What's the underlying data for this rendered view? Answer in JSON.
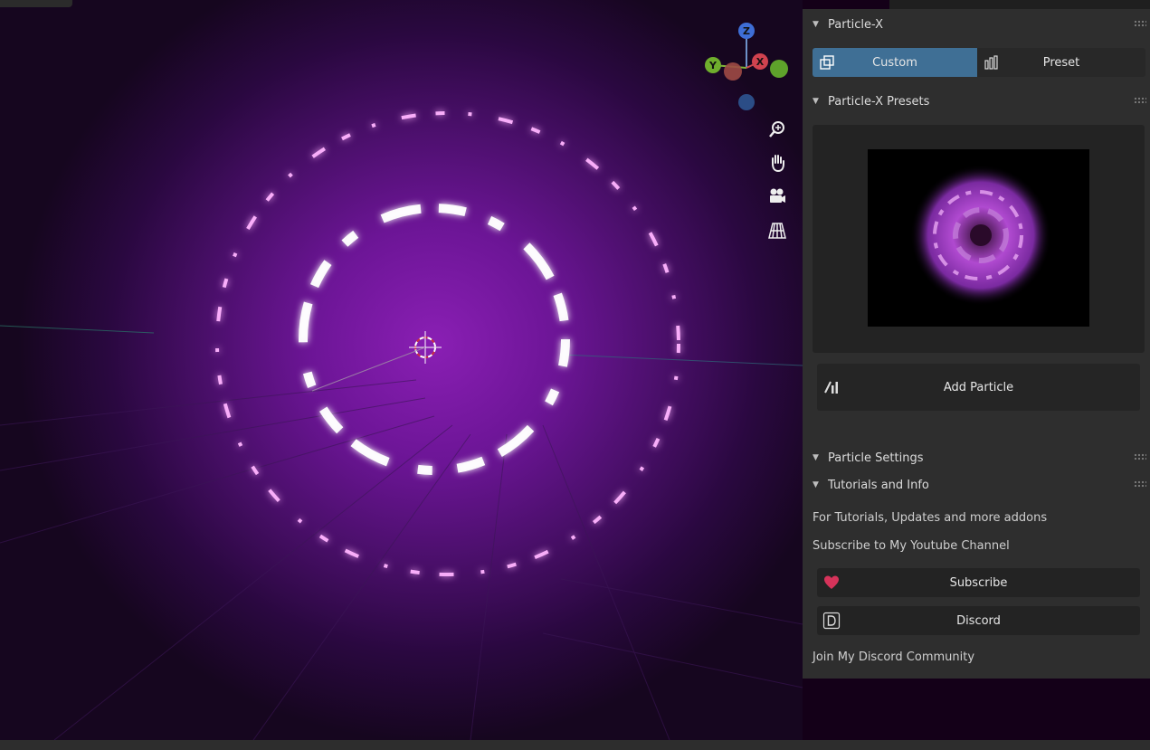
{
  "panels": {
    "particle_x": {
      "title": "Particle-X",
      "tabs": [
        {
          "label": "Custom",
          "active": true,
          "icon": "custom-icon"
        },
        {
          "label": "Preset",
          "active": false,
          "icon": "preset-icon"
        }
      ]
    },
    "presets": {
      "title": "Particle-X Presets",
      "add_label": "Add Particle",
      "add_icon": "add-particle-icon"
    },
    "settings": {
      "title": "Particle Settings"
    },
    "tutorials": {
      "title": "Tutorials and Info",
      "line1": "For Tutorials, Updates and more addons",
      "line2": "Subscribe to My Youtube Channel",
      "subscribe_label": "Subscribe",
      "subscribe_icon": "heart-icon",
      "discord_label": "Discord",
      "discord_icon": "discord-icon",
      "footer": "Join My Discord Community"
    }
  },
  "gizmo": {
    "z": "Z",
    "y": "Y",
    "x": "X"
  },
  "colors": {
    "accent": "#3f6f95",
    "heart": "#d6335a",
    "particle": "#ff9cff",
    "viewport_glow": "#8a1fb4"
  }
}
